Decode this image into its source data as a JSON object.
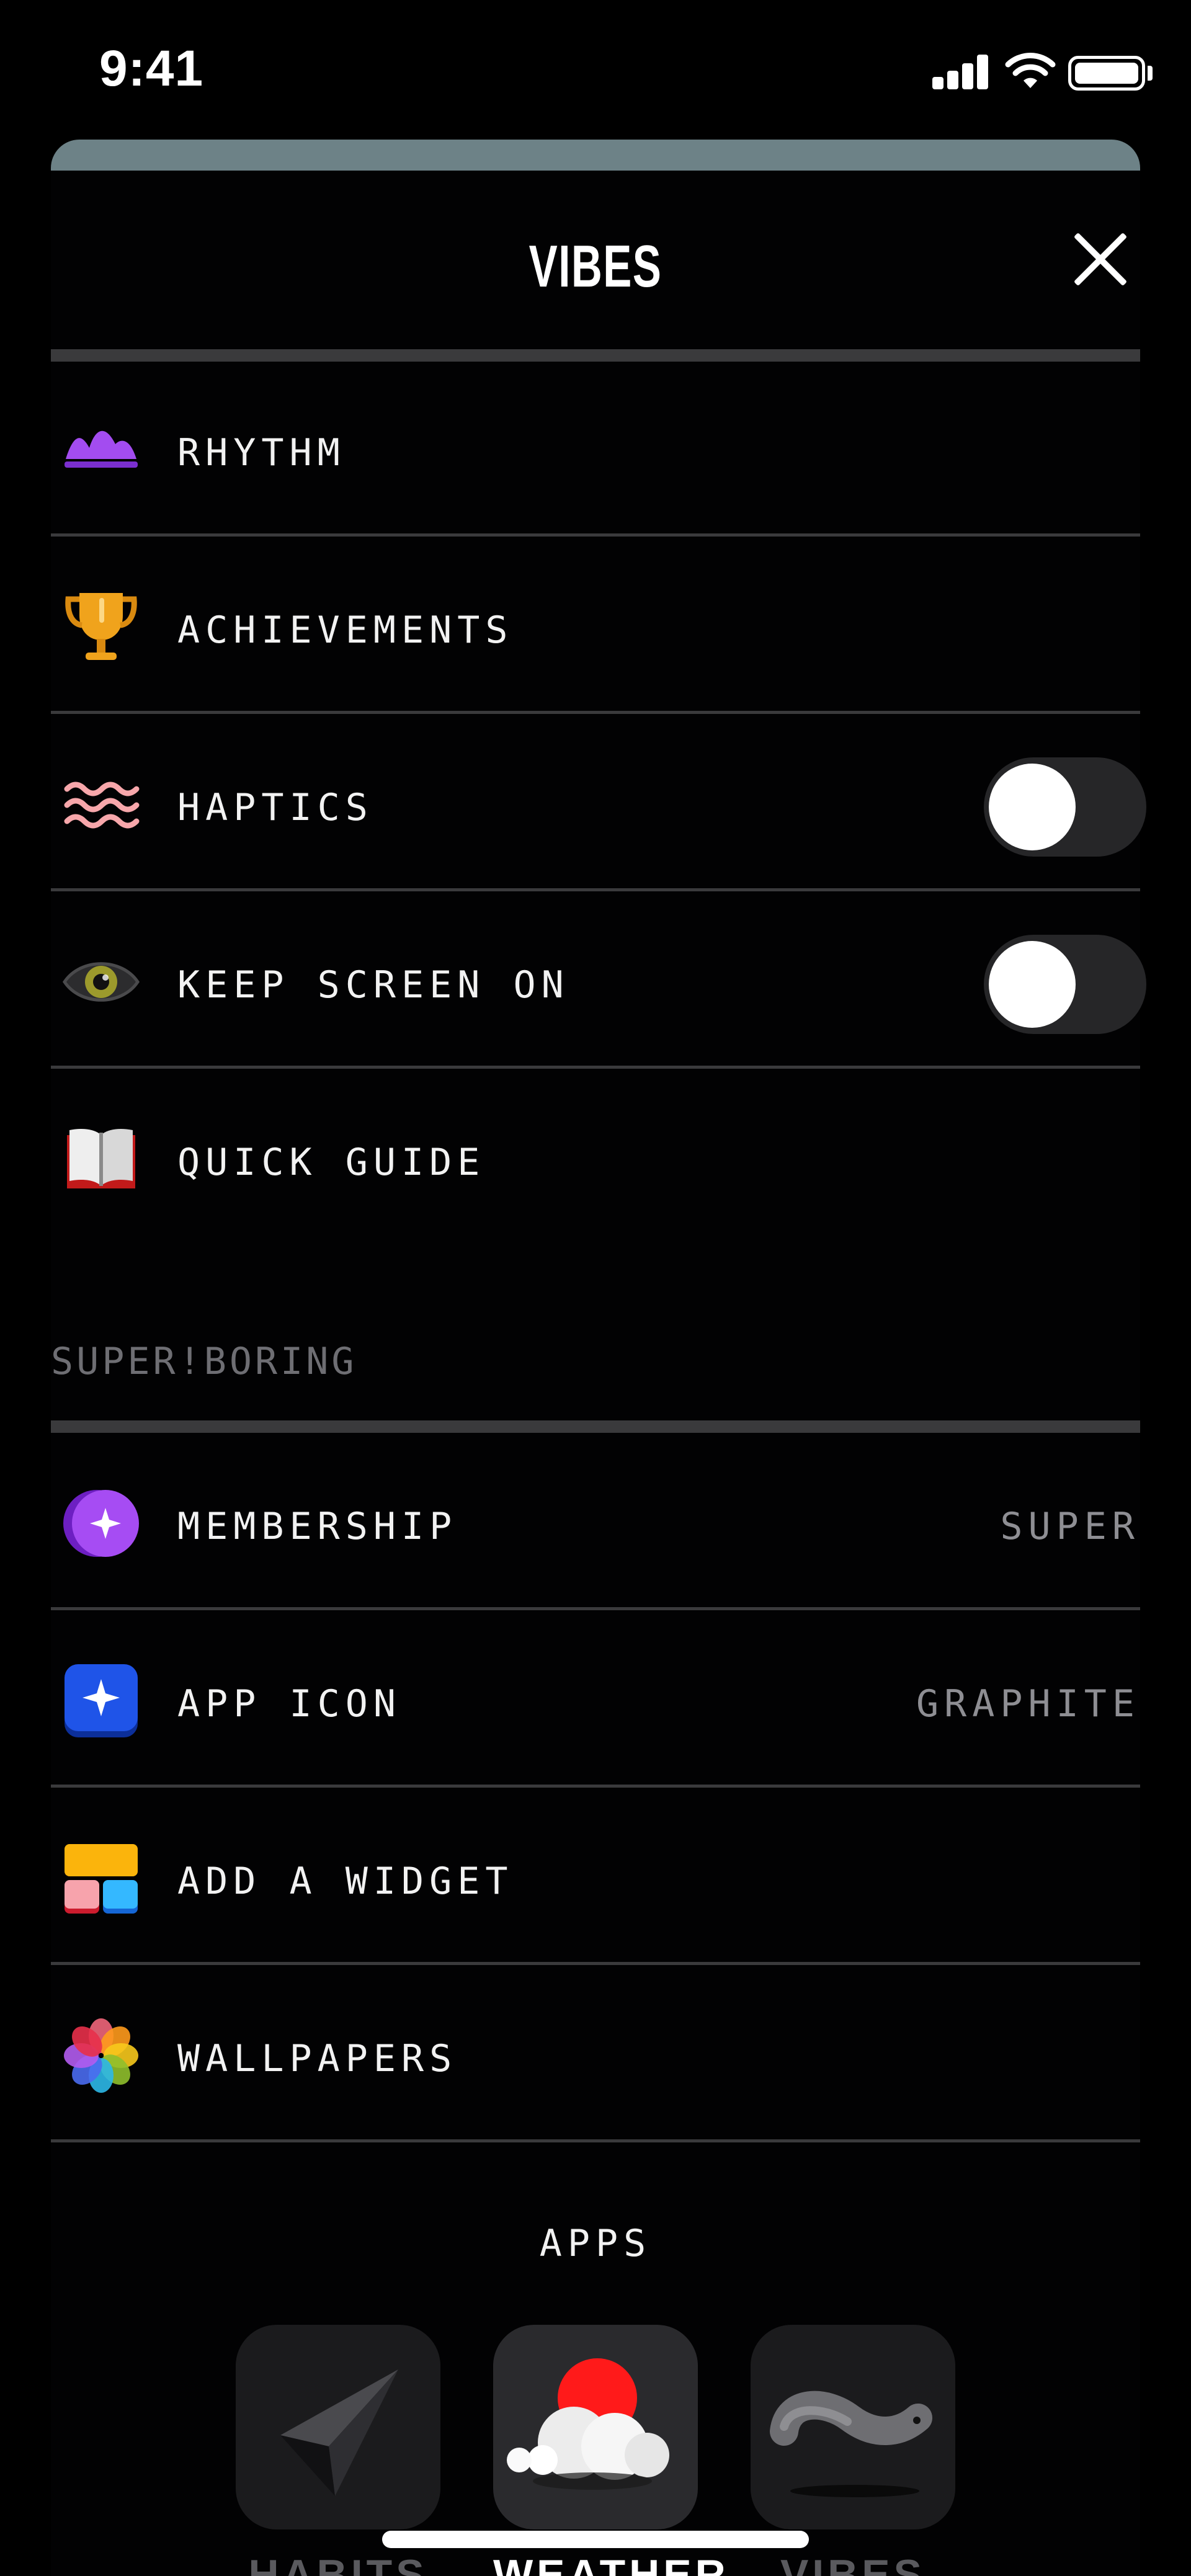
{
  "status_bar": {
    "time": "9:41"
  },
  "sheet": {
    "title": "VIBES",
    "settings_items": [
      {
        "label": "RHYTHM",
        "icon": "rhythm-hills-icon"
      },
      {
        "label": "ACHIEVEMENTS",
        "icon": "trophy-icon"
      },
      {
        "label": "HAPTICS",
        "icon": "waves-icon",
        "toggle_on": false
      },
      {
        "label": "KEEP SCREEN ON",
        "icon": "eye-icon",
        "toggle_on": false
      },
      {
        "label": "QUICK GUIDE",
        "icon": "book-icon"
      }
    ],
    "section_header": "SUPER!BORING",
    "brand_items": [
      {
        "label": "MEMBERSHIP",
        "value": "SUPER",
        "icon": "membership-sparkle-icon"
      },
      {
        "label": "APP ICON",
        "value": "GRAPHITE",
        "icon": "app-icon-sparkle-icon"
      },
      {
        "label": "ADD A WIDGET",
        "icon": "widget-grid-icon"
      },
      {
        "label": "WALLPAPERS",
        "icon": "flower-icon"
      }
    ],
    "apps_label": "APPS",
    "apps": [
      {
        "name": "HABITS",
        "icon": "paper-plane-icon"
      },
      {
        "name": "WEATHER",
        "icon": "cloud-sun-icon",
        "selected": true
      },
      {
        "name": "VIBES",
        "icon": "worm-icon"
      }
    ]
  },
  "colors": {
    "background": "#000000",
    "divider": "#3a3a3c",
    "secondary_text": "#8e8e93",
    "section_text": "#6e6e73",
    "toggle_track": "#262628",
    "sheet_peek": "#6d8287"
  }
}
